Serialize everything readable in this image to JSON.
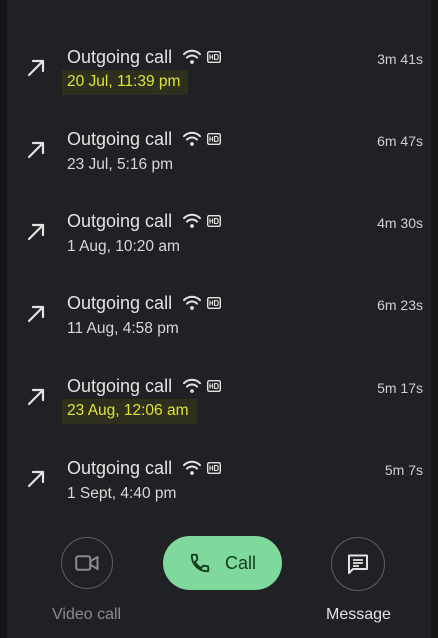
{
  "calls": [
    {
      "title": "Outgoing call",
      "date": "20 Jul, 11:39 pm",
      "duration": "3m 41s",
      "highlighted": true
    },
    {
      "title": "Outgoing call",
      "date": "23 Jul, 5:16 pm",
      "duration": "6m 47s",
      "highlighted": false
    },
    {
      "title": "Outgoing call",
      "date": "1 Aug, 10:20 am",
      "duration": "4m 30s",
      "highlighted": false
    },
    {
      "title": "Outgoing call",
      "date": "11 Aug, 4:58 pm",
      "duration": "6m 23s",
      "highlighted": false
    },
    {
      "title": "Outgoing call",
      "date": "23 Aug, 12:06 am",
      "duration": "5m 17s",
      "highlighted": true
    },
    {
      "title": "Outgoing call",
      "date": "1 Sept, 4:40 pm",
      "duration": "5m 7s",
      "highlighted": false
    }
  ],
  "actions": {
    "video_label": "Video call",
    "call_label": "Call",
    "message_label": "Message"
  },
  "icons": {
    "call_type": "outgoing-arrow-icon",
    "network": "wifi-icon",
    "quality": "hd-icon",
    "video": "videocam-icon",
    "phone": "phone-icon",
    "message": "message-icon"
  },
  "colors": {
    "background": "#202124",
    "highlight_text": "#dfe52f",
    "call_button": "#7fd89c"
  }
}
